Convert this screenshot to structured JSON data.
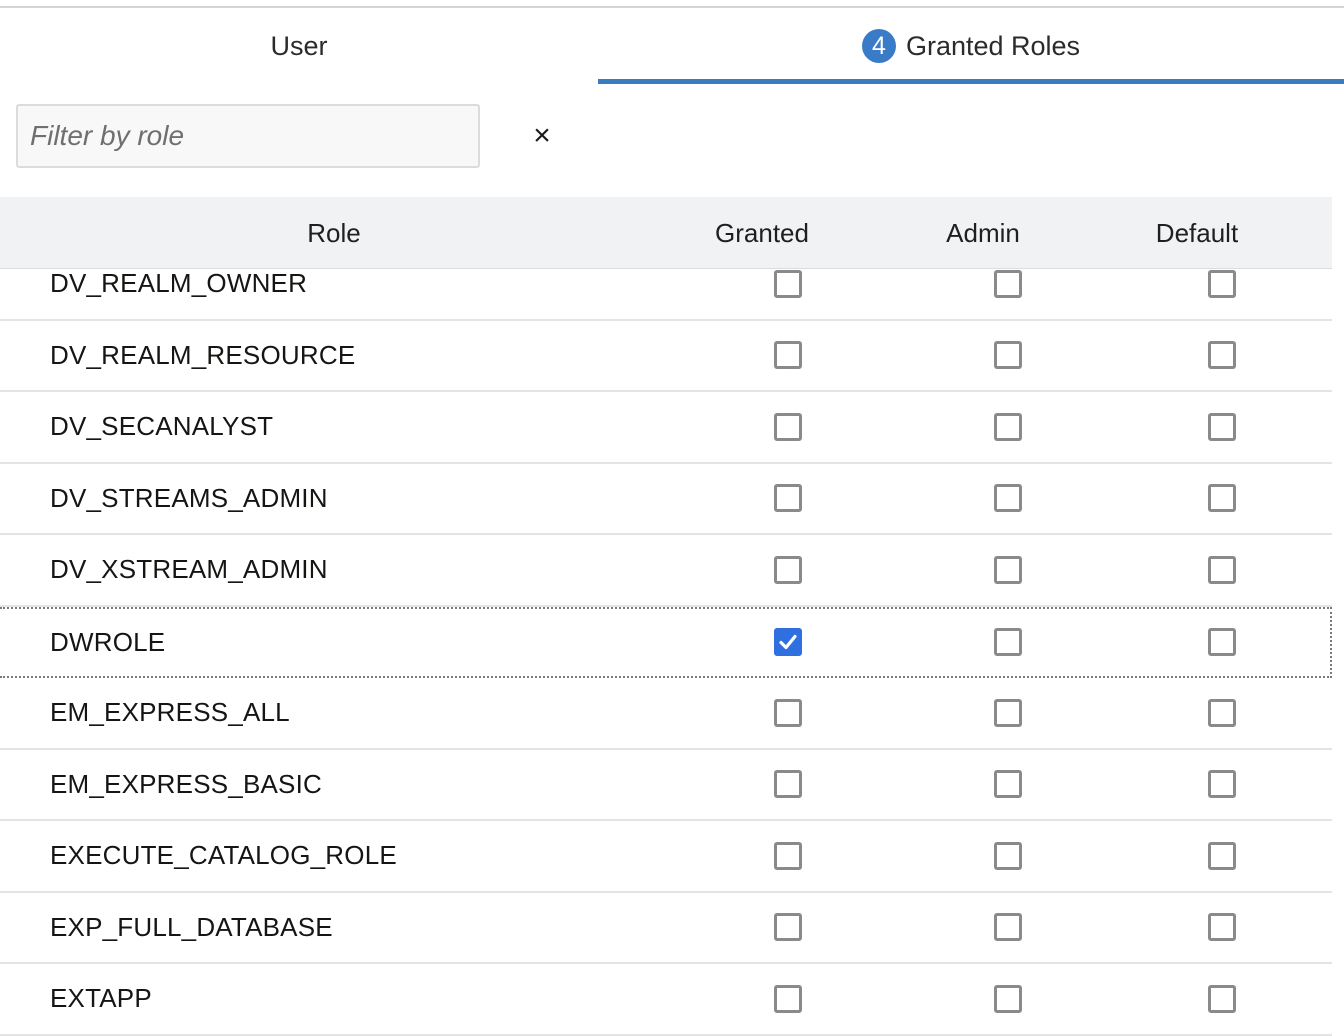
{
  "tabs": {
    "user_label": "User",
    "granted_label": "Granted Roles",
    "granted_count": "4"
  },
  "filter": {
    "placeholder": "Filter by role",
    "value": "",
    "clear_label": "×"
  },
  "table": {
    "columns": [
      "Role",
      "Granted",
      "Admin",
      "Default"
    ],
    "rows": [
      {
        "role": "DV_REALM_OWNER",
        "granted": false,
        "admin": false,
        "default": false
      },
      {
        "role": "DV_REALM_RESOURCE",
        "granted": false,
        "admin": false,
        "default": false
      },
      {
        "role": "DV_SECANALYST",
        "granted": false,
        "admin": false,
        "default": false
      },
      {
        "role": "DV_STREAMS_ADMIN",
        "granted": false,
        "admin": false,
        "default": false
      },
      {
        "role": "DV_XSTREAM_ADMIN",
        "granted": false,
        "admin": false,
        "default": false
      },
      {
        "role": "DWROLE",
        "granted": true,
        "admin": false,
        "default": false
      },
      {
        "role": "EM_EXPRESS_ALL",
        "granted": false,
        "admin": false,
        "default": false
      },
      {
        "role": "EM_EXPRESS_BASIC",
        "granted": false,
        "admin": false,
        "default": false
      },
      {
        "role": "EXECUTE_CATALOG_ROLE",
        "granted": false,
        "admin": false,
        "default": false
      },
      {
        "role": "EXP_FULL_DATABASE",
        "granted": false,
        "admin": false,
        "default": false
      },
      {
        "role": "EXTAPP",
        "granted": false,
        "admin": false,
        "default": false
      }
    ],
    "focused_row": 5
  },
  "colors": {
    "accent": "#3a7bbf",
    "checkbox_checked": "#2f6fe0",
    "header_bg": "#f1f2f4"
  }
}
